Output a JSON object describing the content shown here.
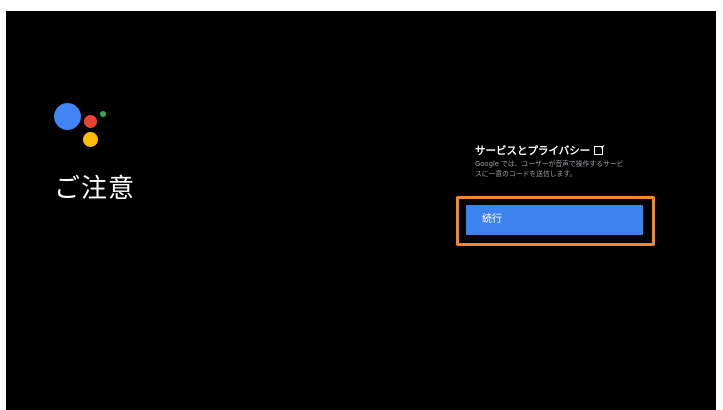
{
  "screen": {
    "title": "ご注意"
  },
  "assistant_logo": {
    "colors": {
      "blue": "#4285F4",
      "red": "#EA4335",
      "yellow": "#FBBC05",
      "green": "#34A853"
    }
  },
  "privacy_panel": {
    "heading": "サービスとプライバシー",
    "heading_icon": "open-external-icon",
    "description": "Google では、ユーザーが音声で操作するサービスに一意のコードを送信します。"
  },
  "actions": {
    "continue_label": "続行"
  },
  "colors": {
    "background": "#000000",
    "button": "#3D83ED",
    "focus_ring": "#F4862C"
  }
}
